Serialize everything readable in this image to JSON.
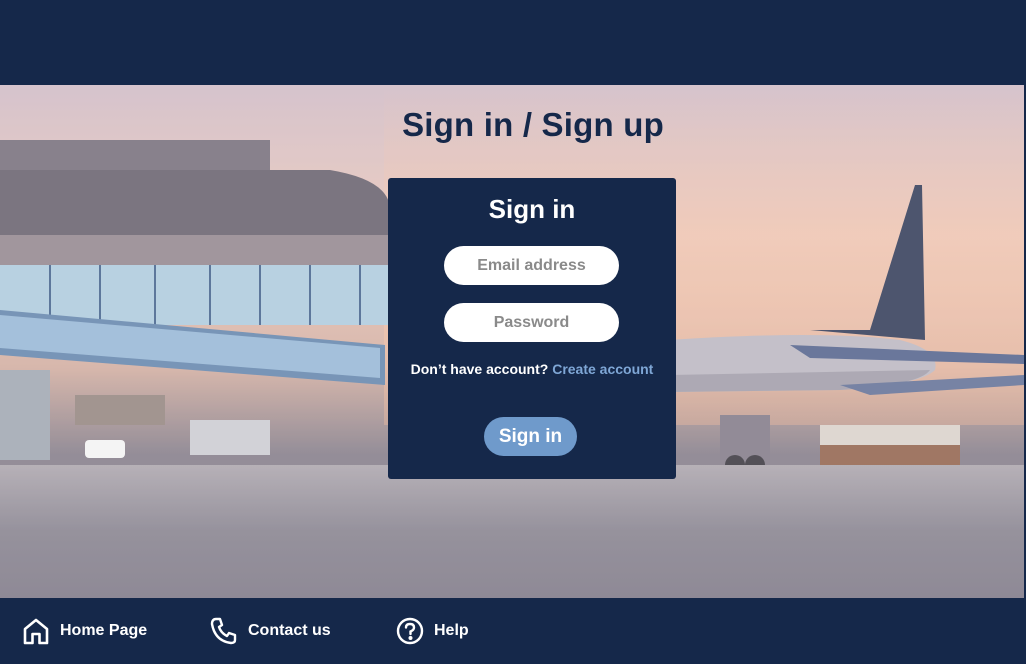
{
  "page": {
    "title": "Sign in / Sign up"
  },
  "login_card": {
    "title": "Sign in",
    "email_placeholder": "Email address",
    "password_placeholder": "Password",
    "no_account_text": "Don’t have account?",
    "create_account_link": "Create account",
    "submit_label": "Sign in"
  },
  "footer": {
    "items": [
      {
        "label": "Home Page",
        "icon": "home-icon"
      },
      {
        "label": "Contact us",
        "icon": "phone-icon"
      },
      {
        "label": "Help",
        "icon": "help-icon"
      }
    ]
  },
  "colors": {
    "navy": "#15284a",
    "accent_button": "#6f9acb",
    "link": "#7fa7d6"
  }
}
